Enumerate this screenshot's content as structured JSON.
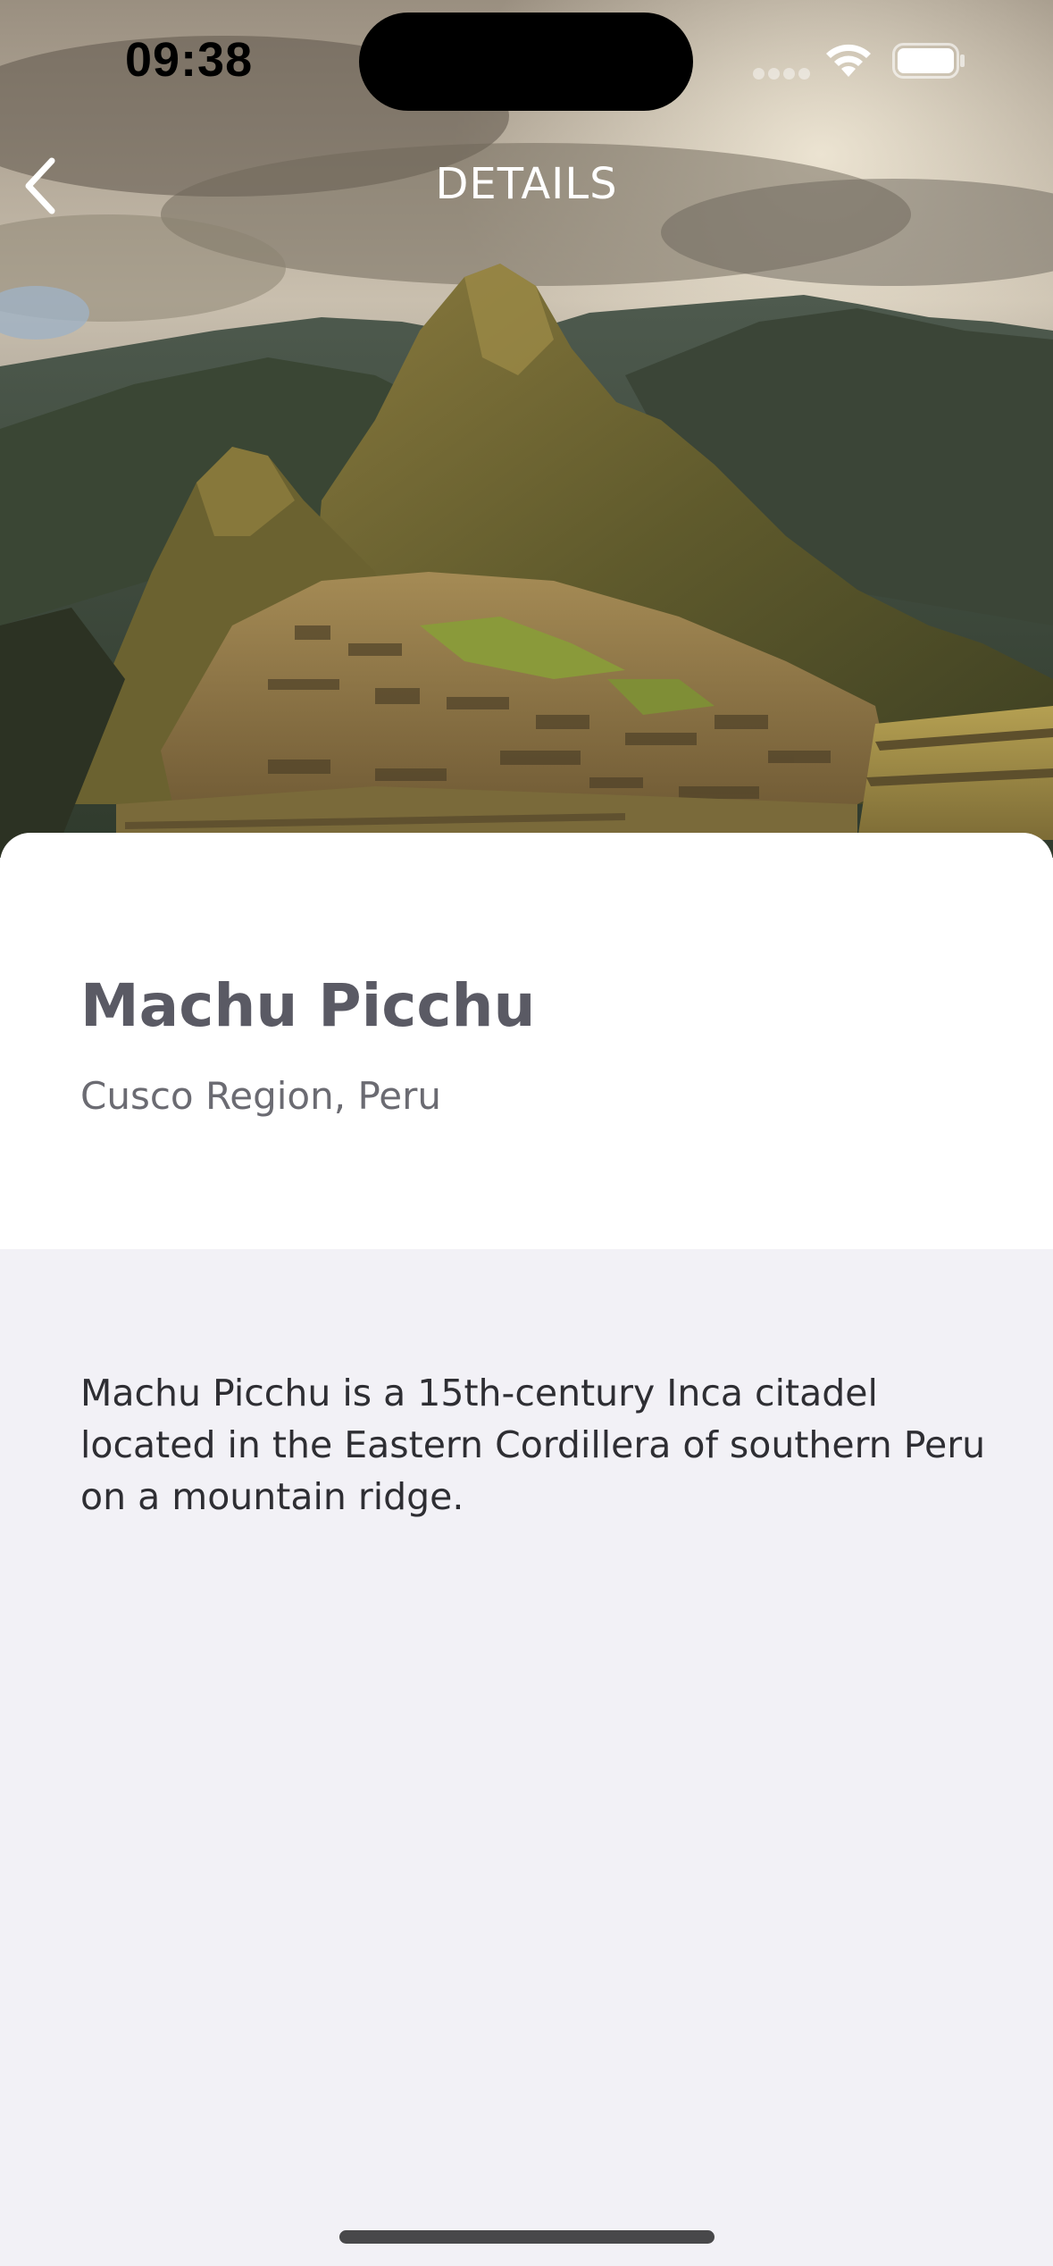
{
  "status_bar": {
    "time": "09:38",
    "signal_icon": "cellular-signal-icon",
    "wifi_icon": "wifi-icon",
    "battery_icon": "battery-icon"
  },
  "nav": {
    "back_icon": "chevron-left-icon",
    "title": "DETAILS"
  },
  "hero": {
    "image": "mountain-ruins-photo"
  },
  "place": {
    "name": "Machu Picchu",
    "region": "Cusco Region, Peru"
  },
  "description": "Machu Picchu is a 15th-century Inca citadel located in the Eastern Cordillera of southern Peru on a mountain ridge.",
  "colors": {
    "card_background": "#ffffff",
    "page_background": "#f2f1f6",
    "title_text": "#5a5a64",
    "body_text": "#2e2e33"
  }
}
